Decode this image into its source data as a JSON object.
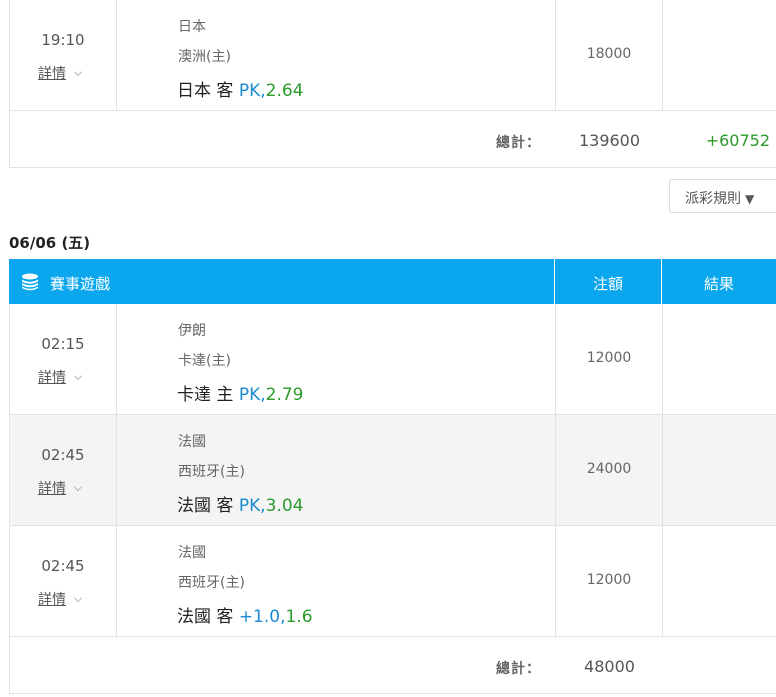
{
  "section1": {
    "rows": [
      {
        "time": "19:10",
        "detail": "詳情",
        "team1": "日本",
        "team2": "澳洲(主)",
        "pick_main": "日本 客",
        "pick_hcp": "PK,",
        "pick_odds": "2.64",
        "amount": "18000",
        "result": ""
      }
    ],
    "total_label": "總計：",
    "total_amount": "139600",
    "total_result": "+60752"
  },
  "rules_button": {
    "label": "派彩規則",
    "arrow": "▼"
  },
  "section2": {
    "date": "06/06 (五)",
    "header": {
      "icon": "coin-stack-icon",
      "col_game": "賽事遊戲",
      "col_bet": "注額",
      "col_result": "結果"
    },
    "rows": [
      {
        "time": "02:15",
        "detail": "詳情",
        "team1": "伊朗",
        "team2": "卡達(主)",
        "pick_main": "卡達 主",
        "pick_hcp": "PK,",
        "pick_odds": "2.79",
        "amount": "12000",
        "result": ""
      },
      {
        "time": "02:45",
        "detail": "詳情",
        "team1": "法國",
        "team2": "西班牙(主)",
        "pick_main": "法國 客",
        "pick_hcp": "PK,",
        "pick_odds": "3.04",
        "amount": "24000",
        "result": ""
      },
      {
        "time": "02:45",
        "detail": "詳情",
        "team1": "法國",
        "team2": "西班牙(主)",
        "pick_main": "法國 客",
        "pick_hcp": "+1.0,",
        "pick_odds": "1.6",
        "amount": "12000",
        "result": ""
      }
    ],
    "total_label": "總計：",
    "total_amount": "48000",
    "total_result": ""
  },
  "colors": {
    "header_bg": "#0aa7ee",
    "handicap": "#1b8cd1",
    "odds": "#2a9a2a",
    "profit": "#2a9a2a"
  }
}
